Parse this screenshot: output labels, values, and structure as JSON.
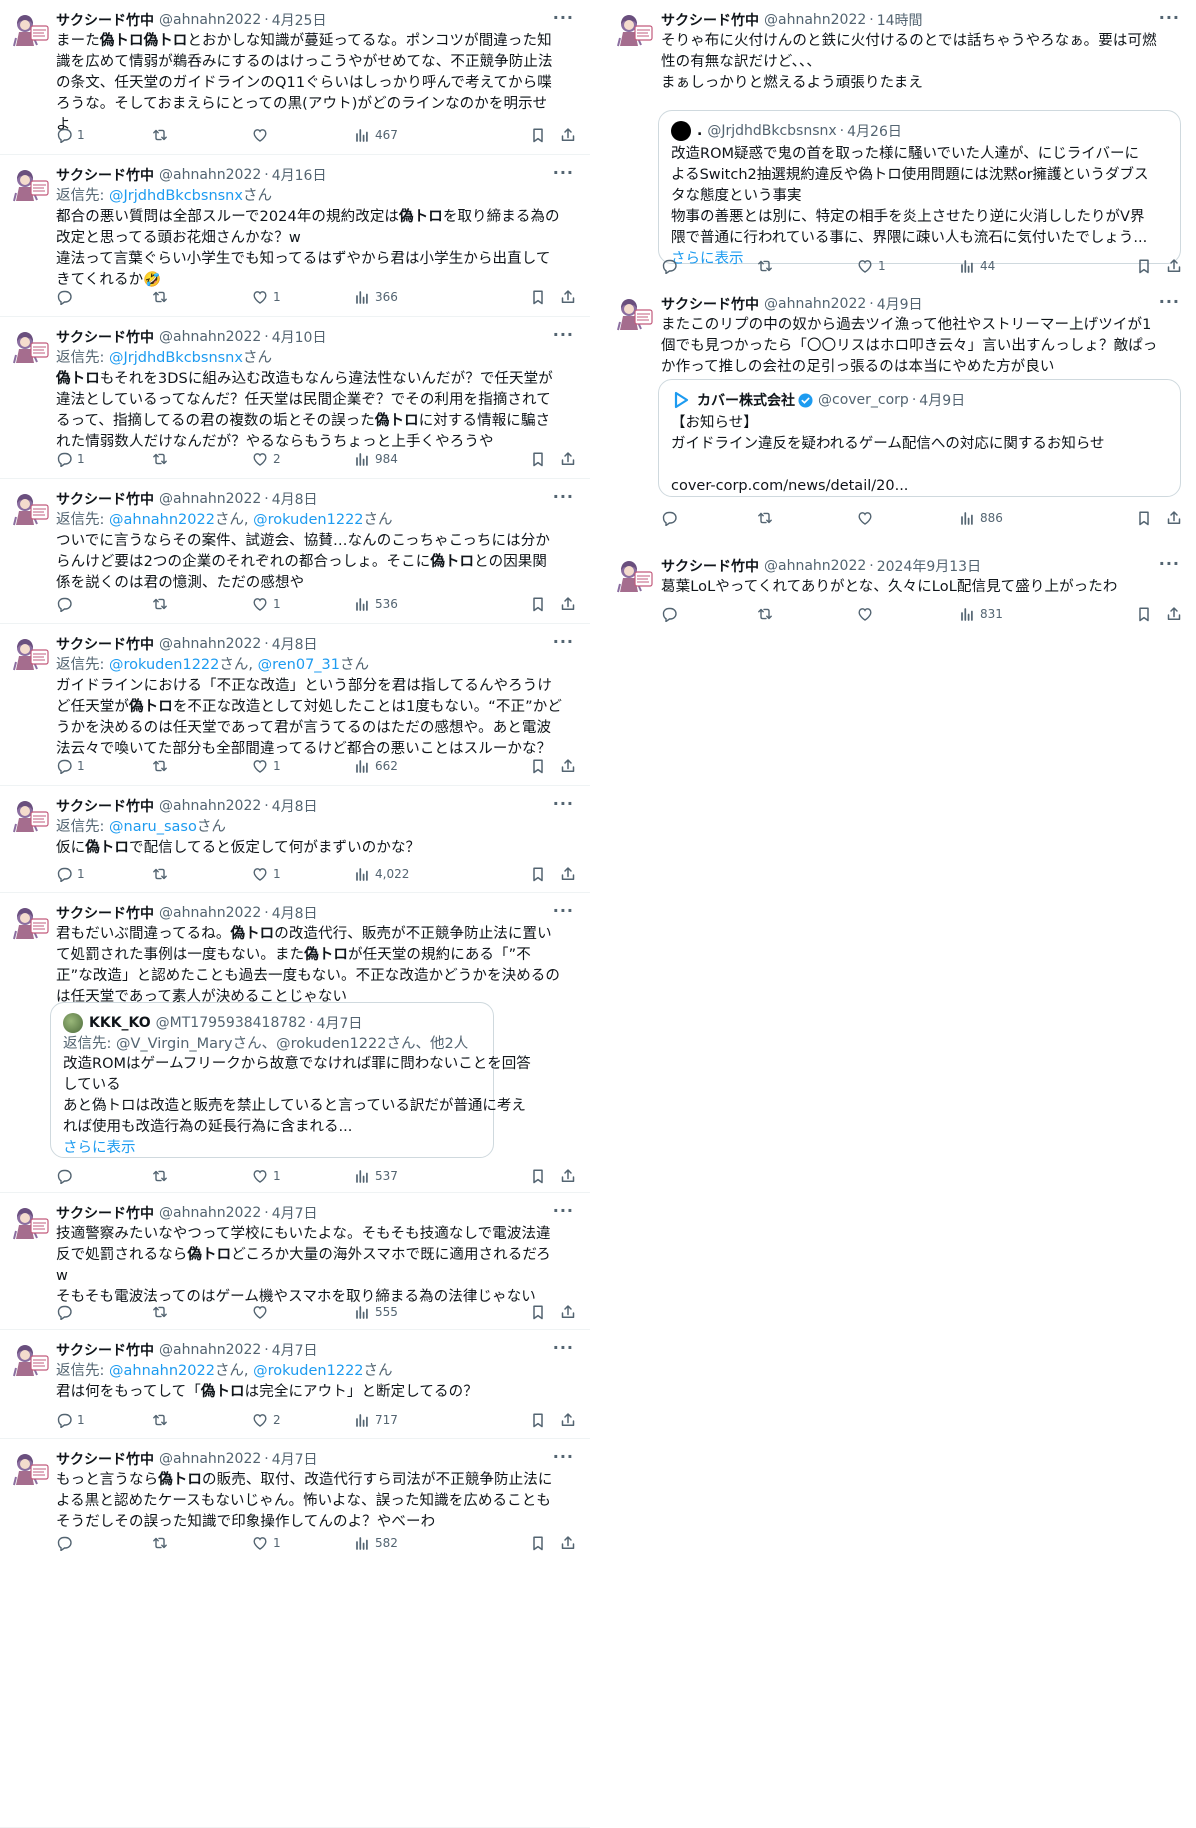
{
  "user": {
    "name": "サクシード竹中",
    "handle": "@ahnahn2022"
  },
  "left": [
    {
      "date": "4月25日",
      "reply_to": null,
      "lines": [
        [
          [
            "まーた",
            0
          ],
          [
            "偽トロ偽トロ",
            1
          ],
          [
            "とおかしな知識が蔓延ってるな。ポンコツが間違った知",
            0
          ]
        ],
        [
          [
            "識を広めて情弱が鵜呑みにするのはけっこうやがせめてな、不正競争防止法",
            0
          ]
        ],
        [
          [
            "の条文、任天堂のガイドラインのQ11ぐらいはしっかり呼んで考えてから喋",
            0
          ]
        ],
        [
          [
            "ろうな。そしておまえらにとっての黒(アウト)がどのラインなのかを明示せ",
            0
          ]
        ],
        [
          [
            "よ",
            0
          ]
        ]
      ],
      "reply": "1",
      "retweet": "",
      "like": "",
      "views": "467"
    },
    {
      "date": "4月16日",
      "reply_to": {
        "prefix": "返信先: ",
        "links": [
          "@JrjdhdBkcbsnsnx"
        ],
        "suffix": "さん"
      },
      "lines": [
        [
          [
            "都合の悪い質問は全部スルーで2024年の規約改定は",
            0
          ],
          [
            "偽トロ",
            1
          ],
          [
            "を取り締まる為の",
            0
          ]
        ],
        [
          [
            "改定と思ってる頭お花畑さんかな？w",
            0
          ]
        ],
        [
          [
            "違法って言葉ぐらい小学生でも知ってるはずやから君は小学生から出直して",
            0
          ]
        ],
        [
          [
            "きてくれるか🤣",
            0
          ]
        ]
      ],
      "reply": "",
      "retweet": "",
      "like": "1",
      "views": "366"
    },
    {
      "date": "4月10日",
      "reply_to": {
        "prefix": "返信先: ",
        "links": [
          "@JrjdhdBkcbsnsnx"
        ],
        "suffix": "さん"
      },
      "lines": [
        [
          [
            "偽トロ",
            1
          ],
          [
            "もそれを3DSに組み込む改造もなんら違法性ないんだが？で任天堂が",
            0
          ]
        ],
        [
          [
            "違法としているってなんだ？任天堂は民間企業ぞ？でその利用を指摘されて",
            0
          ]
        ],
        [
          [
            "るって、指摘してるの君の複数の垢とその誤った",
            0
          ],
          [
            "偽トロ",
            1
          ],
          [
            "に対する情報に騙さ",
            0
          ]
        ],
        [
          [
            "れた情弱数人だけなんだが？やるならもうちょっと上手くやろうや",
            0
          ]
        ]
      ],
      "reply": "1",
      "retweet": "",
      "like": "2",
      "views": "984"
    },
    {
      "date": "4月8日",
      "reply_to": {
        "prefix": "返信先: ",
        "links": [
          "@ahnahn2022",
          "@rokuden1222"
        ],
        "suffix": "さん"
      },
      "lines": [
        [
          [
            "ついでに言うならその案件、試遊会、協賛…なんのこっちゃこっちには分か",
            0
          ]
        ],
        [
          [
            "らんけど要は2つの企業のそれぞれの都合っしょ。そこに",
            0
          ],
          [
            "偽トロ",
            1
          ],
          [
            "との因果関",
            0
          ]
        ],
        [
          [
            "係を説くのは君の憶測、ただの感想や",
            0
          ]
        ]
      ],
      "reply": "",
      "retweet": "",
      "like": "1",
      "views": "536"
    },
    {
      "date": "4月8日",
      "reply_to": {
        "prefix": "返信先: ",
        "links": [
          "@rokuden1222",
          "@ren07_31"
        ],
        "suffix": "さん"
      },
      "lines": [
        [
          [
            "ガイドラインにおける「不正な改造」という部分を君は指してるんやろうけ",
            0
          ]
        ],
        [
          [
            "ど任天堂が",
            0
          ],
          [
            "偽トロ",
            1
          ],
          [
            "を不正な改造として対処したことは1度もない。“不正”かど",
            0
          ]
        ],
        [
          [
            "うかを決めるのは任天堂であって君が言うてるのはただの感想や。あと電波",
            0
          ]
        ],
        [
          [
            "法云々で喚いてた部分も全部間違ってるけど都合の悪いことはスルーかな？",
            0
          ]
        ]
      ],
      "reply": "1",
      "retweet": "",
      "like": "1",
      "views": "662"
    },
    {
      "date": "4月8日",
      "reply_to": {
        "prefix": "返信先: ",
        "links": [
          "@naru_saso"
        ],
        "suffix": "さん"
      },
      "lines": [
        [
          [
            "仮に",
            0
          ],
          [
            "偽トロ",
            1
          ],
          [
            "で配信してると仮定して何がまずいのかな？",
            0
          ]
        ]
      ],
      "reply": "1",
      "retweet": "",
      "like": "1",
      "views": "4,022"
    },
    {
      "date": "4月8日",
      "reply_to": null,
      "lines": [
        [
          [
            "君もだいぶ間違ってるね。",
            0
          ],
          [
            "偽トロ",
            1
          ],
          [
            "の改造代行、販売が不正競争防止法に置い",
            0
          ]
        ],
        [
          [
            "て処罰された事例は一度もない。また",
            0
          ],
          [
            "偽トロ",
            1
          ],
          [
            "が任天堂の規約にある「”不",
            0
          ]
        ],
        [
          [
            "正”な改造」と認めたことも過去一度もない。不正な改造かどうかを決めるの",
            0
          ]
        ],
        [
          [
            "は任天堂であって素人が決めることじゃない",
            0
          ]
        ]
      ],
      "quote": {
        "name": "KKK_KO",
        "handle": "@MT1795938418782",
        "date": "4月7日",
        "reply_to": "返信先: @V_Virgin_Maryさん、@rokuden1222さん、他2人",
        "lines": [
          "改造ROMはゲームフリークから故意でなければ罪に問わないことを回答",
          "している",
          "あと偽トロは改造と販売を禁止していると言っている訳だが普通に考え",
          "れば使用も改造行為の延長行為に含まれる..."
        ],
        "more": "さらに表示"
      },
      "reply": "",
      "retweet": "",
      "like": "1",
      "views": "537"
    },
    {
      "date": "4月7日",
      "reply_to": null,
      "lines": [
        [
          [
            "技適警察みたいなやつって学校にもいたよな。そもそも技適なしで電波法違",
            0
          ]
        ],
        [
          [
            "反で処罰されるなら",
            0
          ],
          [
            "偽トロ",
            1
          ],
          [
            "どころか大量の海外スマホで既に適用されるだろ",
            0
          ]
        ],
        [
          [
            "w",
            0
          ]
        ],
        [
          [
            "そもそも電波法ってのはゲーム機やスマホを取り締まる為の法律じゃない",
            0
          ]
        ]
      ],
      "reply": "",
      "retweet": "",
      "like": "",
      "views": "555"
    },
    {
      "date": "4月7日",
      "reply_to": {
        "prefix": "返信先: ",
        "links": [
          "@ahnahn2022",
          "@rokuden1222"
        ],
        "suffix": "さん"
      },
      "lines": [
        [
          [
            "君は何をもってして「",
            0
          ],
          [
            "偽トロ",
            1
          ],
          [
            "は完全にアウト」と断定してるの？",
            0
          ]
        ]
      ],
      "reply": "1",
      "retweet": "",
      "like": "2",
      "views": "717"
    },
    {
      "date": "4月7日",
      "reply_to": null,
      "lines": [
        [
          [
            "もっと言うなら",
            0
          ],
          [
            "偽トロ",
            1
          ],
          [
            "の販売、取付、改造代行すら司法が不正競争防止法に",
            0
          ]
        ],
        [
          [
            "よる黒と認めたケースもないじゃん。怖いよな、誤った知識を広めることも",
            0
          ]
        ],
        [
          [
            "そうだしその誤った知識で印象操作してんのよ？やべーわ",
            0
          ]
        ]
      ],
      "reply": "",
      "retweet": "",
      "like": "1",
      "views": "582"
    }
  ],
  "right": [
    {
      "date": "14時間",
      "lines": [
        "そりゃ布に火付けんのと鉄に火付けるのとでは話ちゃうやろなぁ。要は可燃",
        "性の有無な訳だけど、、、",
        "まぁしっかりと燃えるよう頑張りたまえ"
      ],
      "quote": {
        "name": ".",
        "handle": "@JrjdhdBkcbsnsnx",
        "date": "4月26日",
        "lines": [
          "改造ROM疑惑で鬼の首を取った様に騒いでいた人達が、にじライバーに",
          "よるSwitch2抽選規約違反や偽トロ使用問題には沈黙or擁護というダブス",
          "タな態度という事実",
          "物事の善悪とは別に、特定の相手を炎上させたり逆に火消ししたりがV界",
          "隈で普通に行われている事に、界隈に疎い人も流石に気付いたでしょう..."
        ],
        "more": "さらに表示"
      },
      "reply": "",
      "retweet": "",
      "like": "1",
      "views": "44"
    },
    {
      "date": "4月9日",
      "lines": [
        "またこのリプの中の奴から過去ツイ漁って他社やストリーマー上げツイが1",
        "個でも見つかったら「〇〇リスはホロ叩き云々」言い出すんっしょ？敵ぱっ",
        "か作って推しの会社の足引っ張るのは本当にやめた方が良い"
      ],
      "quote": {
        "name": "カバー株式会社",
        "handle": "@cover_corp",
        "date": "4月9日",
        "lines": [
          "【お知らせ】",
          "ガイドライン違反を疑われるゲーム配信への対応に関するお知らせ",
          "",
          "cover-corp.com/news/detail/20..."
        ],
        "more": ""
      },
      "reply": "",
      "retweet": "",
      "like": "",
      "views": "886"
    },
    {
      "date": "2024年9月13日",
      "lines": [
        "葛葉LoLやってくれてありがとな、久々にLoL配信見て盛り上がったわ"
      ],
      "quote": null,
      "reply": "",
      "retweet": "",
      "like": "",
      "views": "831"
    }
  ],
  "icons": {
    "reply": "reply-icon",
    "retweet": "retweet-icon",
    "like": "heart-icon",
    "views": "views-icon",
    "bookmark": "bookmark-icon",
    "share": "share-icon",
    "more": "more-icon",
    "verified": "verified-badge-icon"
  },
  "colors": {
    "link": "#1d9bf0",
    "muted": "#536471",
    "border": "#cfd9de",
    "text": "#0f1419"
  }
}
